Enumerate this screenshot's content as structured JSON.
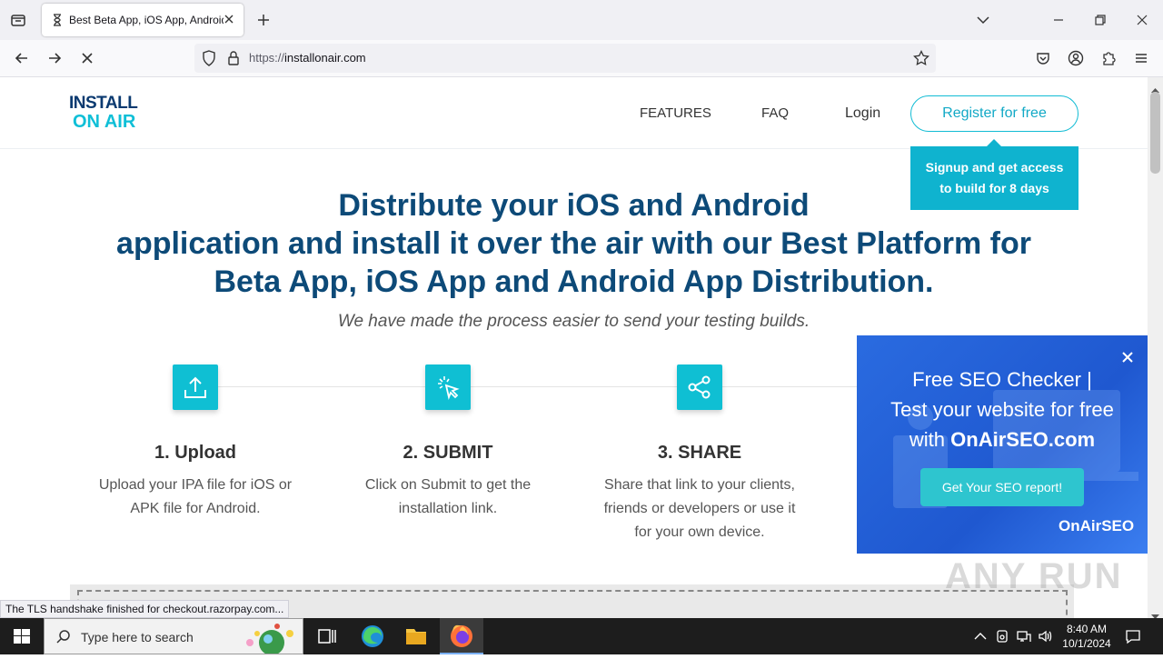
{
  "browser": {
    "tab_title": "Best Beta App, iOS App, Android",
    "url_scheme": "https://",
    "url_host": "installonair.com"
  },
  "site": {
    "logo_top": "INSTALL",
    "logo_bottom": "ON AIR",
    "nav": [
      "FEATURES",
      "FAQ",
      "Login"
    ],
    "register_label": "Register for free",
    "signup_tip_line1": "Signup and get access",
    "signup_tip_line2": "to build for 8 days",
    "hero_line1": "Distribute your iOS and Android",
    "hero_line2": "application and install it over the air with our Best Platform for",
    "hero_line3": "Beta App, iOS App and Android App Distribution.",
    "hero_sub": "We have made the process easier to send your testing builds.",
    "steps": [
      {
        "title": "1. Upload",
        "desc": "Upload your IPA file for iOS or APK file for Android."
      },
      {
        "title": "2. SUBMIT",
        "desc": "Click on Submit to get the installation link."
      },
      {
        "title": "3. SHARE",
        "desc": "Share that link to your clients, friends or developers or use it for your own device."
      }
    ]
  },
  "status_text": "The TLS handshake finished for checkout.razorpay.com...",
  "ad": {
    "title_line1": "Free SEO Checker |",
    "title_line2": "Test your website for free",
    "title_line3_prefix": "with ",
    "title_line3_bold": "OnAirSEO.com",
    "button_label": "Get Your SEO report!",
    "brand": "OnAirSEO"
  },
  "watermark": "ANY RUN",
  "taskbar": {
    "search_placeholder": "Type here to search",
    "time": "8:40 AM",
    "date": "10/1/2024"
  },
  "colors": {
    "accent_teal": "#0fbfd3",
    "hero_blue": "#0d4a78",
    "ad_blue": "#2a6be0"
  }
}
